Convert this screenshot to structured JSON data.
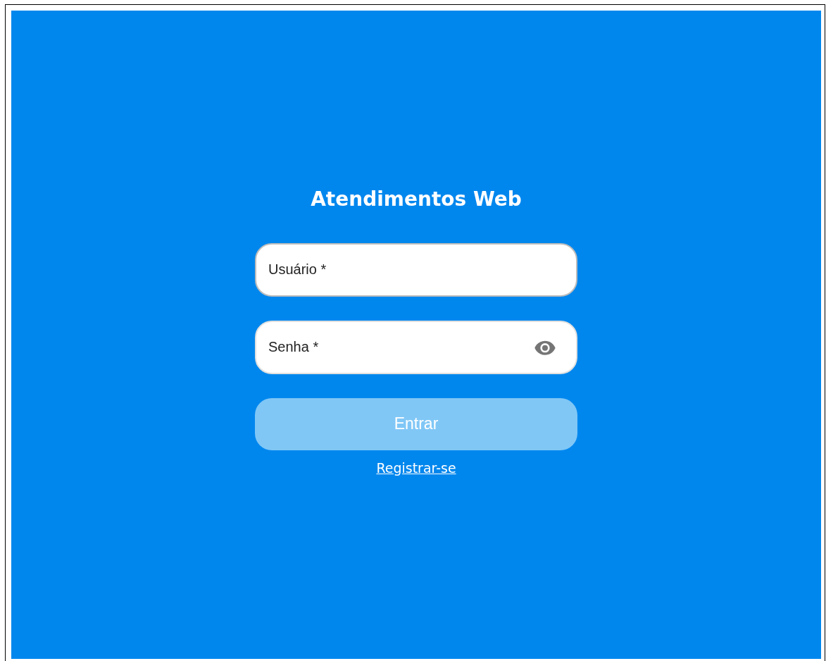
{
  "title": "Atendimentos Web",
  "fields": [
    {
      "kind": "text",
      "placeholder": "Usuário *",
      "highlighted": true
    },
    {
      "kind": "password",
      "placeholder": "Senha *",
      "highlighted": false
    }
  ],
  "submit": {
    "label": "Entrar",
    "disabled": true
  },
  "link": "Registrar-se"
}
